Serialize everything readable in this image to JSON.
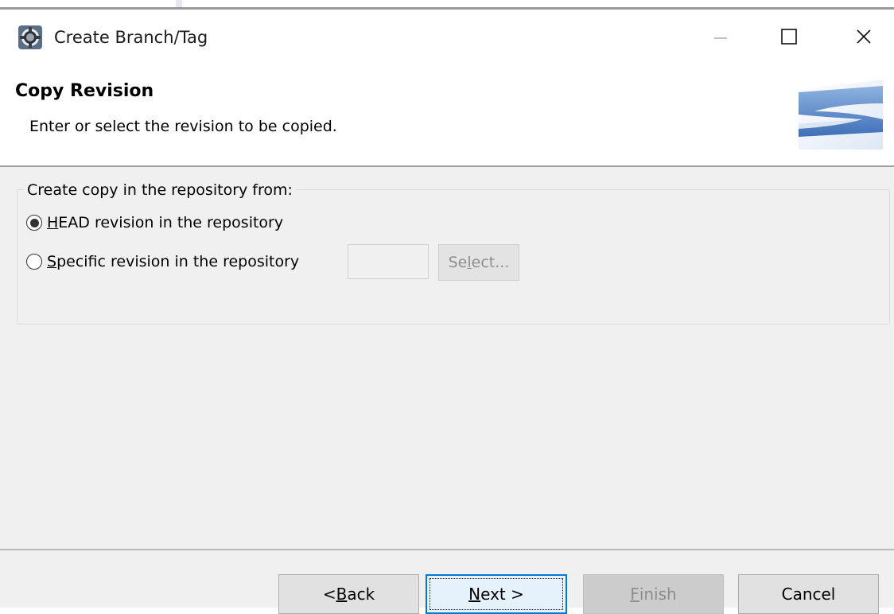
{
  "window": {
    "title": "Create Branch/Tag",
    "icon": "eclipse-gear-icon",
    "controls": [
      "minimize-icon",
      "maximize-icon",
      "close-icon"
    ]
  },
  "banner": {
    "title": "Copy Revision",
    "description": "Enter or select the revision to be copied.",
    "logo": "subversion-logo-icon"
  },
  "group": {
    "legend": "Create copy in the repository from:",
    "options": [
      {
        "mnemonic": "H",
        "rest": "EAD revision in the repository",
        "checked": true
      },
      {
        "mnemonic": "S",
        "rest": "pecific revision in the repository",
        "checked": false
      }
    ],
    "revision_value": "",
    "select_button": {
      "pre": "Se",
      "mnemonic": "l",
      "post": "ect...",
      "enabled": false
    }
  },
  "footer": {
    "back": {
      "pre": "< ",
      "mnemonic": "B",
      "post": "ack"
    },
    "next": {
      "pre": "",
      "mnemonic": "N",
      "post": "ext >"
    },
    "finish": {
      "pre": "",
      "mnemonic": "F",
      "post": "inish",
      "enabled": false
    },
    "cancel": "Cancel"
  },
  "colors": {
    "focus_border": "#0078d7",
    "panel_bg": "#f0f0f0",
    "disabled_text": "#8d8d8d"
  }
}
